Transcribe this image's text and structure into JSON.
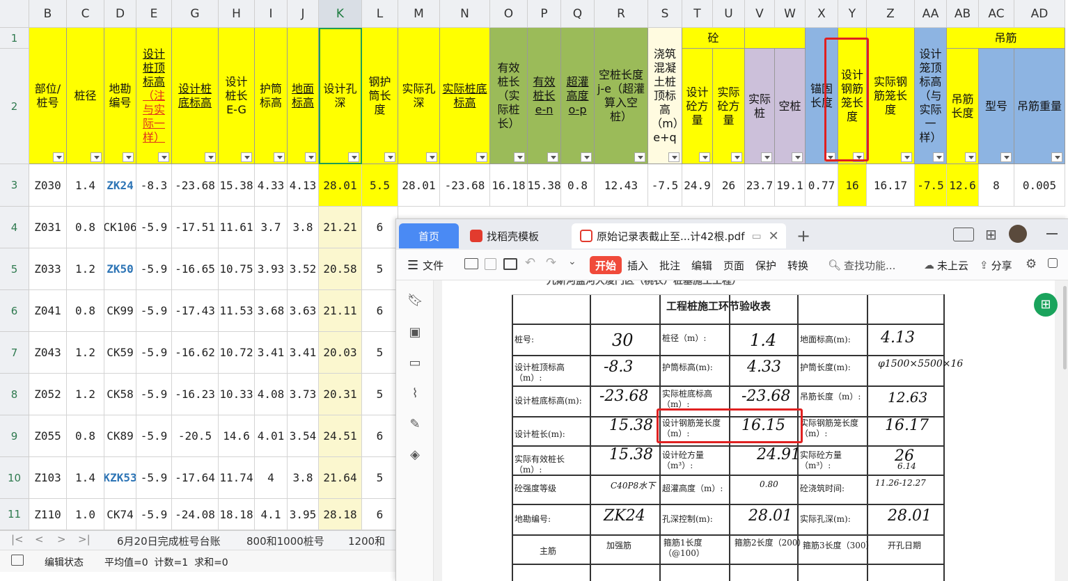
{
  "columns": [
    "B",
    "C",
    "D",
    "E",
    "G",
    "H",
    "I",
    "J",
    "K",
    "L",
    "M",
    "N",
    "O",
    "P",
    "Q",
    "R",
    "S",
    "T",
    "U",
    "V",
    "W",
    "X",
    "Y",
    "Z",
    "AA",
    "AB",
    "AC",
    "AD"
  ],
  "row_numbers": [
    "1",
    "2",
    "3",
    "4",
    "5",
    "6",
    "7",
    "8",
    "9",
    "10",
    "11"
  ],
  "group_headers": {
    "concrete": "砼",
    "rebar": "吊筋"
  },
  "headers": {
    "B": "部位/桩号",
    "C": "桩径",
    "D": "地勘编号",
    "E_a": "设计桩顶标高",
    "E_b": "（注与实际一样）",
    "G": "设计桩底标高",
    "H": "设计桩长E-G",
    "I": "护筒标高",
    "J": "地面标高",
    "K": "设计孔深",
    "L": "钢护筒长度",
    "M": "实际孔深",
    "N": "实际桩底标高",
    "O": "有效桩长（实际桩长）",
    "P": "有效桩长e-n",
    "Q": "超灌高度o-p",
    "R": "空桩长度j-e（超灌算入空桩）",
    "S": "浇筑混凝土桩顶标高（m）e+q",
    "T": "设计砼方量",
    "U": "实际砼方量",
    "V": "实际桩",
    "W": "空桩",
    "X": "锚固长度",
    "Y": "设计钢筋笼长度",
    "Z": "实际钢筋笼长度",
    "AA": "设计笼顶标高（与实际一样）",
    "AB": "吊筋长度",
    "AC": "型号",
    "AD": "吊筋重量"
  },
  "rows": [
    [
      "Z030",
      "1.4",
      "ZK24",
      "-8.3",
      "-23.68",
      "15.38",
      "4.33",
      "4.13",
      "28.01",
      "5.5",
      "28.01",
      "-23.68",
      "16.18",
      "15.38",
      "0.8",
      "12.43",
      "-7.5",
      "24.9",
      "26",
      "23.7",
      "19.1",
      "0.77",
      "16",
      "16.17",
      "-7.5",
      "12.6",
      "8",
      "0.005"
    ],
    [
      "Z031",
      "0.8",
      "CK106",
      "-5.9",
      "-17.51",
      "11.61",
      "3.7",
      "3.8",
      "21.21",
      "6"
    ],
    [
      "Z033",
      "1.2",
      "ZK50",
      "-5.9",
      "-16.65",
      "10.75",
      "3.93",
      "3.52",
      "20.58",
      "5"
    ],
    [
      "Z041",
      "0.8",
      "CK99",
      "-5.9",
      "-17.43",
      "11.53",
      "3.68",
      "3.63",
      "21.11",
      "6"
    ],
    [
      "Z043",
      "1.2",
      "CK59",
      "-5.9",
      "-16.62",
      "10.72",
      "3.41",
      "3.41",
      "20.03",
      "5"
    ],
    [
      "Z052",
      "1.2",
      "CK58",
      "-5.9",
      "-16.23",
      "10.33",
      "4.08",
      "3.73",
      "20.31",
      "5"
    ],
    [
      "Z055",
      "0.8",
      "CK89",
      "-5.9",
      "-20.5",
      "14.6",
      "4.01",
      "3.54",
      "24.51",
      "6"
    ],
    [
      "Z103",
      "1.4",
      "KZK53",
      "-5.9",
      "-17.64",
      "11.74",
      "4",
      "3.8",
      "21.64",
      "5"
    ],
    [
      "Z110",
      "1.0",
      "CK74",
      "-5.9",
      "-24.08",
      "18.18",
      "4.1",
      "3.95",
      "28.18",
      "6"
    ]
  ],
  "sheet_tabs": [
    "6月20日完成桩号台账",
    "800和1000桩号",
    "1200和14"
  ],
  "status": {
    "mode": "编辑状态",
    "summary": "平均值=0  计数=1  求和=0"
  },
  "pdf": {
    "tabs": [
      "首页",
      "找稻壳模板",
      "原始记录表截止至...计42根.pdf"
    ],
    "new_tab": "+",
    "toolbar": [
      "文件",
      "开始",
      "插入",
      "批注",
      "编辑",
      "页面",
      "保护",
      "转换"
    ],
    "search_placeholder": "查找功能...",
    "cloud": "未上云",
    "share": "分享",
    "doc": {
      "header_cut": "九斯河盐河大凌门区（桃农）桩基施工工程）",
      "title": "工程桩施工环节验收表",
      "labels": {
        "pile_no": "桩号:",
        "diameter": "桩径（m）:",
        "ground": "地面标高(m):",
        "top_elev": "设计桩顶标高（m）:",
        "casing_elev": "护筒标高(m):",
        "casing_len": "护筒长度(m):",
        "bottom_elev": "设计桩底标高(m):",
        "actual_bottom": "实际桩底标高（m）:",
        "hanger": "吊筋长度（m）:",
        "design_len": "设计桩长(m):",
        "design_cage": "设计钢筋笼长度（m）:",
        "actual_cage": "实际钢筋笼长度（m）:",
        "eff_len": "实际有效桩长（m）:",
        "design_conc": "设计砼方量（m³）:",
        "actual_conc": "实际砼方量（m³）:",
        "grade": "砼强度等级",
        "overpour": "超灌高度（m）:",
        "pour_time": "砼浇筑时间:",
        "survey": "地勘编号:",
        "hole_ctrl": "孔深控制(m):",
        "actual_hole": "实际孔深(m):",
        "main_bar": "主筋",
        "strengthen": "加强筋",
        "stir1": "箍筋1长度（@100）",
        "stir2": "箍筋2长度（200）",
        "stir3": "箍筋3长度（300）",
        "start": "开孔日期"
      },
      "values": {
        "pile_no": "30",
        "diameter": "1.4",
        "ground": "4.13",
        "top_elev": "-8.3",
        "casing_elev": "4.33",
        "casing_len": "φ1500×5500×16",
        "bottom_elev": "-23.68",
        "actual_bottom": "-23.68",
        "hanger": "12.63",
        "design_len": "15.38",
        "design_cage": "16.15",
        "actual_cage": "16.17",
        "eff_len": "15.38",
        "design_conc": "24.91",
        "actual_conc": "26",
        "actual_conc_note": "6.14",
        "grade": "C40P8水下",
        "overpour": "0.80",
        "pour_time": "11.26-12.27",
        "survey": "ZK24",
        "hole_ctrl": "28.01",
        "actual_hole": "28.01"
      }
    }
  }
}
